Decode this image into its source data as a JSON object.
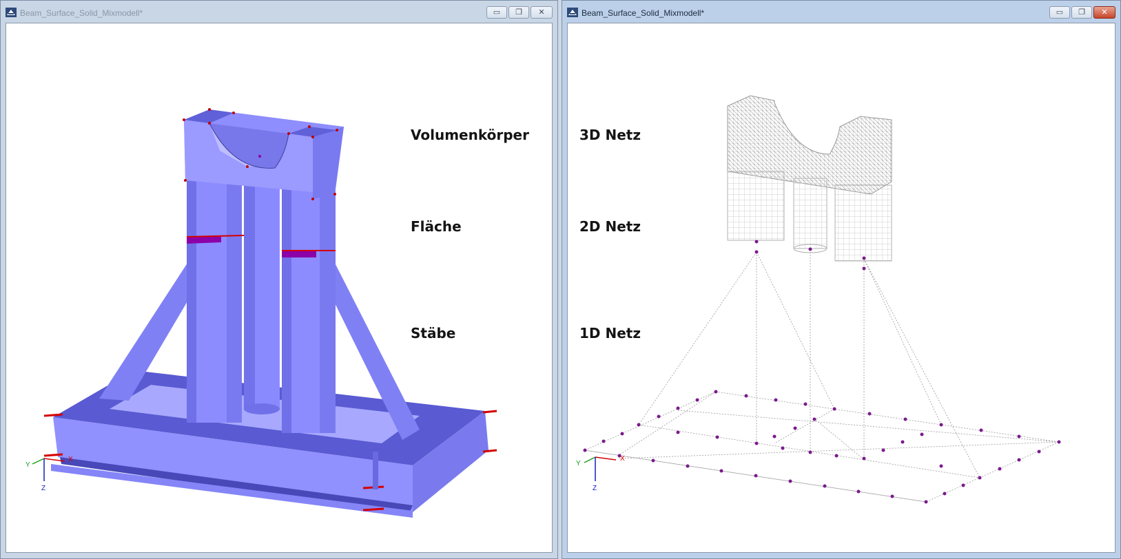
{
  "windows": {
    "left": {
      "title": "Beam_Surface_Solid_Mixmodell*",
      "labels": {
        "solid": "Volumenkörper",
        "surface": "Fläche",
        "members": "Stäbe"
      },
      "axes": {
        "x": "X",
        "y": "Y",
        "z": "Z"
      }
    },
    "right": {
      "title": "Beam_Surface_Solid_Mixmodell*",
      "labels": {
        "mesh3d": "3D Netz",
        "mesh2d": "2D Netz",
        "mesh1d": "1D Netz"
      },
      "axes": {
        "x": "X",
        "y": "Y",
        "z": "Z"
      }
    }
  },
  "controls": {
    "minimize": "▭",
    "restore": "❐",
    "close": "✕"
  },
  "colors": {
    "model_fill": "#8c8cff",
    "model_dark": "#4646b4",
    "surface_magenta": "#8b00a8",
    "edge_red": "#d40000",
    "mesh_gray": "#a8a8a8",
    "fe_node_purple": "#7a1a8c"
  },
  "icons": [
    "app-icon",
    "minimize-icon",
    "restore-icon",
    "close-icon"
  ]
}
